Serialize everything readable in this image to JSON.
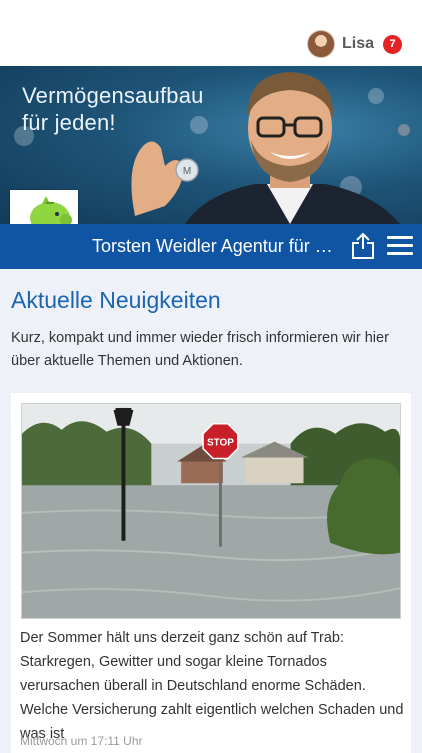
{
  "user": {
    "name": "Lisa",
    "badge_count": "7"
  },
  "banner": {
    "line1": "Vermögensaufbau",
    "line2": "für jeden!"
  },
  "agency": {
    "title": "Torsten Weidler Agentur für D..."
  },
  "icons": {
    "share": "share-icon",
    "menu": "hamburger-menu-icon",
    "logo": "piggy-bank-logo"
  },
  "colors": {
    "primary": "#0f55a3",
    "heading": "#1a64b4",
    "badge": "#e42424"
  },
  "section": {
    "title": "Aktuelle Neuigkeiten",
    "intro": "Kurz, kompakt und immer wieder frisch informieren wir hier über aktuelle Themen und Aktionen."
  },
  "news": [
    {
      "text": "Der Sommer hält uns derzeit ganz schön auf Trab: Starkregen, Gewitter und sogar kleine Tornados verursachen überall in Deutschland enorme Schäden. Welche Versicherung zahlt eigentlich welchen Schaden und was ist",
      "time": "Mittwoch um 17:11 Uhr",
      "stop_sign": "STOP"
    }
  ]
}
